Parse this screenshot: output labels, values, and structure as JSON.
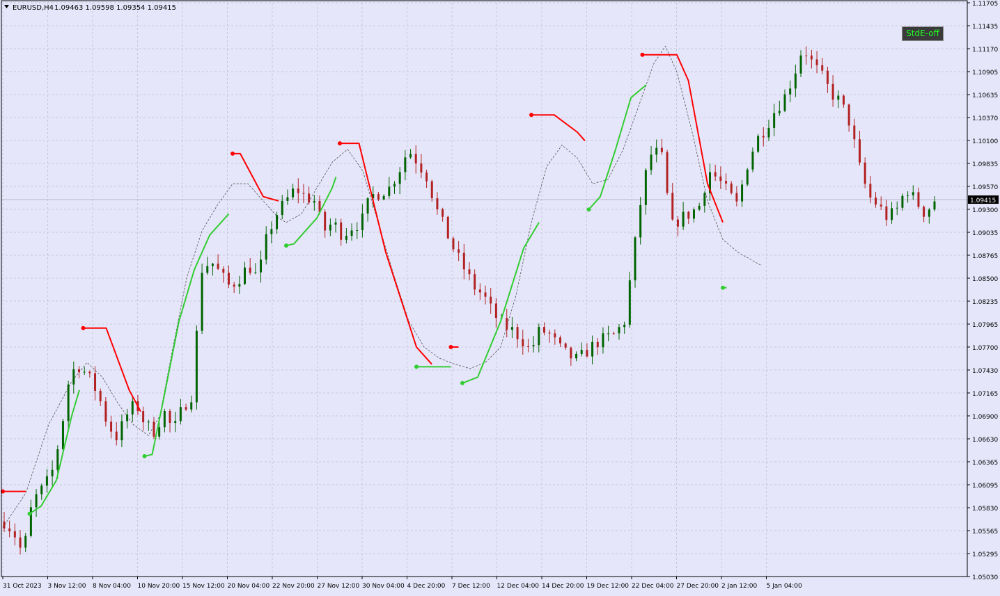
{
  "header": {
    "symbol_label": "EURUSD,H4",
    "ohlc": "1.09463 1.09598 1.09354 1.09415"
  },
  "stde_button": {
    "label": "StdE-off"
  },
  "colors": {
    "background": "#e6e6fa",
    "bull": "#006400",
    "bear": "#b22222",
    "band_up": "#32cd32",
    "band_down": "#ff0000",
    "mid_line": "#555555",
    "grid": "#c8c8dc",
    "price_tag_bg": "#000000",
    "price_tag_text": "#ffffff"
  },
  "chart_data": {
    "type": "candlestick",
    "title": "EURUSD,H4",
    "ylim": [
      1.0503,
      1.11705
    ],
    "y_ticks": [
      "1.11705",
      "1.11435",
      "1.11170",
      "1.10905",
      "1.10635",
      "1.10370",
      "1.10100",
      "1.09835",
      "1.09570",
      "1.09300",
      "1.09035",
      "1.08765",
      "1.08500",
      "1.08235",
      "1.07965",
      "1.07700",
      "1.07430",
      "1.07165",
      "1.06900",
      "1.06630",
      "1.06365",
      "1.06095",
      "1.05830",
      "1.05565",
      "1.05295",
      "1.05030"
    ],
    "x_ticks": [
      "31 Oct 2023",
      "3 Nov 12:00",
      "8 Nov 04:00",
      "10 Nov 20:00",
      "15 Nov 12:00",
      "20 Nov 04:00",
      "22 Nov 20:00",
      "27 Nov 12:00",
      "30 Nov 04:00",
      "4 Dec 20:00",
      "7 Dec 12:00",
      "12 Dec 04:00",
      "14 Dec 20:00",
      "19 Dec 12:00",
      "22 Dec 04:00",
      "27 Dec 20:00",
      "2 Jan 12:00",
      "5 Jan 04:00"
    ],
    "current_price": 1.09415,
    "current_price_label": "1.09415",
    "bar_count": 175,
    "path_points": [
      [
        0,
        1.0567
      ],
      [
        2,
        1.0555
      ],
      [
        4,
        1.0528
      ],
      [
        6,
        1.059
      ],
      [
        8,
        1.0604
      ],
      [
        10,
        1.062
      ],
      [
        12,
        1.0668
      ],
      [
        14,
        1.074
      ],
      [
        16,
        1.0748
      ],
      [
        18,
        1.0735
      ],
      [
        20,
        1.0715
      ],
      [
        22,
        1.068
      ],
      [
        24,
        1.0665
      ],
      [
        26,
        1.069
      ],
      [
        28,
        1.0705
      ],
      [
        30,
        1.068
      ],
      [
        32,
        1.0672
      ],
      [
        34,
        1.0695
      ],
      [
        36,
        1.0672
      ],
      [
        38,
        1.07
      ],
      [
        40,
        1.0715
      ],
      [
        42,
        1.086
      ],
      [
        44,
        1.087
      ],
      [
        46,
        1.0855
      ],
      [
        48,
        1.084
      ],
      [
        50,
        1.085
      ],
      [
        52,
        1.0865
      ],
      [
        54,
        1.085
      ],
      [
        56,
        1.09
      ],
      [
        58,
        1.0925
      ],
      [
        60,
        1.094
      ],
      [
        62,
        1.0955
      ],
      [
        64,
        1.0945
      ],
      [
        66,
        1.094
      ],
      [
        68,
        1.0905
      ],
      [
        70,
        1.0915
      ],
      [
        72,
        1.09
      ],
      [
        74,
        1.091
      ],
      [
        76,
        1.0915
      ],
      [
        78,
        1.0945
      ],
      [
        80,
        1.095
      ],
      [
        82,
        1.0955
      ],
      [
        84,
        1.0975
      ],
      [
        86,
        1.1
      ],
      [
        88,
        1.0985
      ],
      [
        90,
        1.0968
      ],
      [
        92,
        1.093
      ],
      [
        94,
        1.0905
      ],
      [
        96,
        1.088
      ],
      [
        98,
        1.086
      ],
      [
        100,
        1.084
      ],
      [
        102,
        1.083
      ],
      [
        104,
        1.081
      ],
      [
        106,
        1.0795
      ],
      [
        108,
        1.079
      ],
      [
        110,
        1.078
      ],
      [
        112,
        1.0765
      ],
      [
        114,
        1.079
      ],
      [
        116,
        1.0785
      ],
      [
        118,
        1.077
      ],
      [
        120,
        1.076
      ],
      [
        122,
        1.0755
      ],
      [
        124,
        1.0765
      ],
      [
        126,
        1.0775
      ],
      [
        128,
        1.078
      ],
      [
        130,
        1.0785
      ],
      [
        132,
        1.08
      ],
      [
        134,
        1.088
      ],
      [
        136,
        1.096
      ],
      [
        138,
        1.1
      ],
      [
        140,
        1.099
      ],
      [
        142,
        1.091
      ],
      [
        144,
        1.092
      ],
      [
        146,
        1.0925
      ],
      [
        148,
        1.0935
      ],
      [
        150,
        1.0975
      ],
      [
        152,
        1.0965
      ],
      [
        154,
        1.095
      ],
      [
        156,
        1.0935
      ],
      [
        158,
        1.098
      ],
      [
        160,
        1.101
      ],
      [
        162,
        1.1025
      ],
      [
        164,
        1.1045
      ],
      [
        166,
        1.106
      ],
      [
        168,
        1.1085
      ],
      [
        170,
        1.112
      ],
      [
        172,
        1.11
      ],
      [
        174,
        1.1085
      ],
      [
        176,
        1.1065
      ],
      [
        178,
        1.1055
      ],
      [
        180,
        1.103
      ],
      [
        182,
        1.098
      ],
      [
        184,
        1.0945
      ],
      [
        186,
        1.0935
      ],
      [
        188,
        1.092
      ],
      [
        190,
        1.093
      ],
      [
        192,
        1.0955
      ],
      [
        194,
        1.094
      ],
      [
        196,
        1.0925
      ],
      [
        198,
        1.0941
      ]
    ],
    "mid_line_points": [
      [
        0,
        1.056
      ],
      [
        6,
        1.06
      ],
      [
        12,
        1.068
      ],
      [
        18,
        1.073
      ],
      [
        22,
        1.0752
      ],
      [
        26,
        1.0735
      ],
      [
        30,
        1.0705
      ],
      [
        34,
        1.068
      ],
      [
        38,
        1.0667
      ],
      [
        41,
        1.069
      ],
      [
        44,
        1.076
      ],
      [
        48,
        1.085
      ],
      [
        52,
        1.0905
      ],
      [
        56,
        1.0935
      ],
      [
        60,
        1.096
      ],
      [
        64,
        1.096
      ],
      [
        68,
        1.094
      ],
      [
        72,
        1.092
      ],
      [
        74,
        1.0915
      ],
      [
        78,
        1.0925
      ],
      [
        82,
        1.0955
      ],
      [
        86,
        1.0985
      ],
      [
        90,
        1.1
      ],
      [
        94,
        1.0975
      ],
      [
        98,
        1.0915
      ],
      [
        102,
        1.0855
      ],
      [
        106,
        1.08
      ],
      [
        110,
        1.077
      ],
      [
        114,
        1.0757
      ],
      [
        118,
        1.075
      ],
      [
        122,
        1.0745
      ],
      [
        126,
        1.0752
      ],
      [
        130,
        1.077
      ],
      [
        134,
        1.083
      ],
      [
        138,
        1.0915
      ],
      [
        142,
        1.098
      ],
      [
        146,
        1.1005
      ],
      [
        150,
        1.099
      ],
      [
        154,
        1.096
      ],
      [
        158,
        1.0965
      ],
      [
        162,
        1.1
      ],
      [
        166,
        1.105
      ],
      [
        170,
        1.11
      ],
      [
        173,
        1.112
      ],
      [
        176,
        1.109
      ],
      [
        180,
        1.102
      ],
      [
        184,
        1.094
      ],
      [
        188,
        1.0895
      ],
      [
        192,
        1.088
      ],
      [
        196,
        1.087
      ],
      [
        198,
        1.0865
      ]
    ],
    "bands": [
      {
        "type": "down",
        "points": [
          [
            0,
            1.0602
          ],
          [
            6,
            1.0602
          ]
        ]
      },
      {
        "type": "up",
        "points": [
          [
            7,
            1.0576
          ],
          [
            10,
            1.0585
          ],
          [
            14,
            1.0615
          ],
          [
            18,
            1.069
          ],
          [
            20,
            1.072
          ]
        ]
      },
      {
        "type": "down",
        "points": [
          [
            21,
            1.0792
          ],
          [
            27,
            1.0792
          ],
          [
            33,
            1.072
          ],
          [
            36,
            1.0695
          ]
        ]
      },
      {
        "type": "up",
        "points": [
          [
            37,
            1.0643
          ],
          [
            39,
            1.0645
          ],
          [
            42,
            1.071
          ],
          [
            46,
            1.08
          ],
          [
            50,
            1.086
          ],
          [
            54,
            1.09
          ],
          [
            59,
            1.0925
          ]
        ]
      },
      {
        "type": "down",
        "points": [
          [
            60,
            1.0995
          ],
          [
            62,
            1.0995
          ],
          [
            68,
            1.0945
          ],
          [
            72,
            1.094
          ]
        ]
      },
      {
        "type": "up",
        "points": [
          [
            74,
            1.0888
          ],
          [
            76,
            1.089
          ],
          [
            82,
            1.092
          ],
          [
            86,
            1.0955
          ],
          [
            87,
            1.0968
          ]
        ]
      },
      {
        "type": "down",
        "points": [
          [
            88,
            1.1007
          ],
          [
            93,
            1.1007
          ],
          [
            100,
            1.088
          ],
          [
            108,
            1.077
          ],
          [
            112,
            1.075
          ]
        ]
      },
      {
        "type": "up",
        "points": [
          [
            108,
            1.0747
          ],
          [
            117,
            1.0747
          ]
        ]
      },
      {
        "type": "down",
        "points": [
          [
            117,
            1.077
          ],
          [
            119,
            1.077
          ]
        ]
      },
      {
        "type": "up",
        "points": [
          [
            120,
            1.0728
          ],
          [
            124,
            1.0735
          ],
          [
            130,
            1.08
          ],
          [
            136,
            1.0885
          ],
          [
            140,
            1.0915
          ]
        ]
      },
      {
        "type": "down",
        "points": [
          [
            138,
            1.104
          ],
          [
            144,
            1.104
          ],
          [
            150,
            1.102
          ],
          [
            152,
            1.101
          ]
        ]
      },
      {
        "type": "up",
        "points": [
          [
            153,
            1.093
          ],
          [
            156,
            1.0945
          ],
          [
            160,
            1.1
          ],
          [
            164,
            1.106
          ],
          [
            168,
            1.1075
          ]
        ]
      },
      {
        "type": "down",
        "points": [
          [
            167,
            1.111
          ],
          [
            176,
            1.111
          ],
          [
            179,
            1.108
          ],
          [
            184,
            1.096
          ],
          [
            188,
            1.0915
          ]
        ]
      },
      {
        "type": "up",
        "points": [
          [
            188,
            1.0839
          ],
          [
            189,
            1.0839
          ]
        ]
      }
    ]
  }
}
